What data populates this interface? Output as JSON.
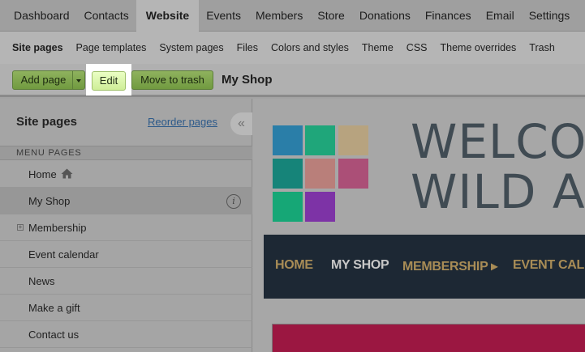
{
  "topnav": {
    "items": [
      {
        "label": "Dashboard"
      },
      {
        "label": "Contacts"
      },
      {
        "label": "Website",
        "active": true
      },
      {
        "label": "Events"
      },
      {
        "label": "Members"
      },
      {
        "label": "Store"
      },
      {
        "label": "Donations"
      },
      {
        "label": "Finances"
      },
      {
        "label": "Email"
      },
      {
        "label": "Settings"
      }
    ]
  },
  "subnav": {
    "items": [
      {
        "label": "Site pages",
        "active": true
      },
      {
        "label": "Page templates"
      },
      {
        "label": "System pages"
      },
      {
        "label": "Files"
      },
      {
        "label": "Colors and styles"
      },
      {
        "label": "Theme"
      },
      {
        "label": "CSS"
      },
      {
        "label": "Theme overrides"
      },
      {
        "label": "Trash"
      }
    ]
  },
  "toolbar": {
    "add_page_label": "Add page",
    "edit_label": "Edit",
    "move_to_trash_label": "Move to trash",
    "current_page_title": "My Shop",
    "button_color": "#7fa54d",
    "edit_highlight_color": "#d9f5a8"
  },
  "sidebar": {
    "title": "Site pages",
    "reorder_label": "Reorder pages",
    "collapse_glyph": "«",
    "section_label": "MENU PAGES",
    "pages": [
      {
        "label": "Home",
        "icon": "home-icon"
      },
      {
        "label": "My Shop",
        "selected": true,
        "icon": "info-icon",
        "info_glyph": "i"
      },
      {
        "label": "Membership",
        "expandable": true,
        "expand_glyph": "+"
      },
      {
        "label": "Event calendar"
      },
      {
        "label": "News"
      },
      {
        "label": "Make a gift"
      },
      {
        "label": "Contact us"
      }
    ]
  },
  "preview": {
    "heading_line1": "WELCO",
    "heading_line2": "WILD AI",
    "logo_colors": [
      "#2a7ea8",
      "#1fa67a",
      "#b7a37f",
      "#168479",
      "#b97f7a",
      "#ab4f77",
      "#16a776",
      "#7d33a6"
    ],
    "nav_items": [
      {
        "label": "HOME"
      },
      {
        "label": "MY SHOP",
        "active": true
      },
      {
        "label": "MEMBERSHIP ▸"
      },
      {
        "label": "EVENT CALEN"
      }
    ],
    "nav_bg_color": "#1d2834",
    "banner_color": "#9b1741"
  }
}
